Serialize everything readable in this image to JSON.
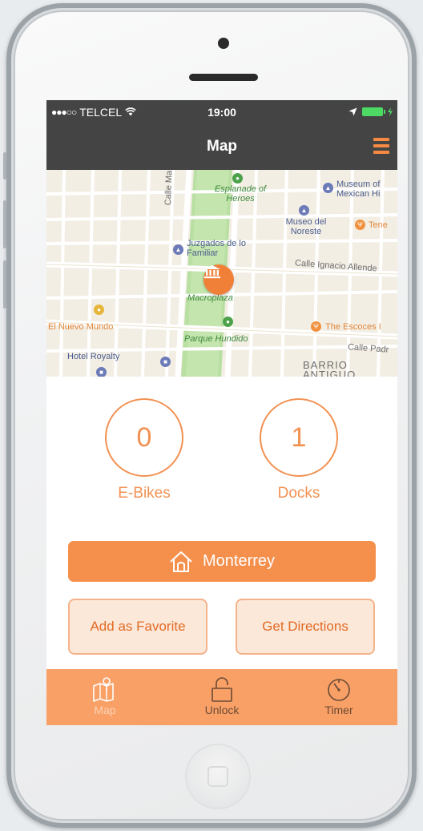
{
  "status_bar": {
    "signal": "●●●○○",
    "carrier": "TELCEL",
    "time": "19:00"
  },
  "nav": {
    "title": "Map",
    "menu_icon": "hamburger-icon"
  },
  "map": {
    "labels": {
      "esplanade": "Esplanade of Heroes",
      "museum": "Museum of Mexican Hi",
      "museo_noreste": "Museo del Noreste",
      "tene": "Tene",
      "juzgados": "Juzgados de lo Familiar",
      "calle_allende": "Calle Ignacio Allende",
      "macroplaza": "Macroplaza",
      "el_nuevo_mundo": "El Nuevo Mundo",
      "parque_hundido": "Parque Hundido",
      "the_escoces": "The Escoces I",
      "hotel_royalty": "Hotel Royalty",
      "calle_padre": "Calle Padr",
      "barrio_antiguo": "BARRIO ANTIGUO",
      "calle_ma": "Calle Ma"
    },
    "pin_icon": "museum-pin-icon"
  },
  "station": {
    "ebikes_count": "0",
    "ebikes_label": "E-Bikes",
    "docks_count": "1",
    "docks_label": "Docks",
    "name": "Monterrey",
    "name_icon": "home-icon"
  },
  "actions": {
    "favorite_label": "Add as Favorite",
    "directions_label": "Get Directions"
  },
  "tabs": [
    {
      "label": "Map",
      "icon": "map-icon"
    },
    {
      "label": "Unlock",
      "icon": "unlock-icon"
    },
    {
      "label": "Timer",
      "icon": "timer-icon"
    }
  ],
  "colors": {
    "accent": "#f58f4c",
    "header": "#444444",
    "tabbar": "#f9a066"
  }
}
